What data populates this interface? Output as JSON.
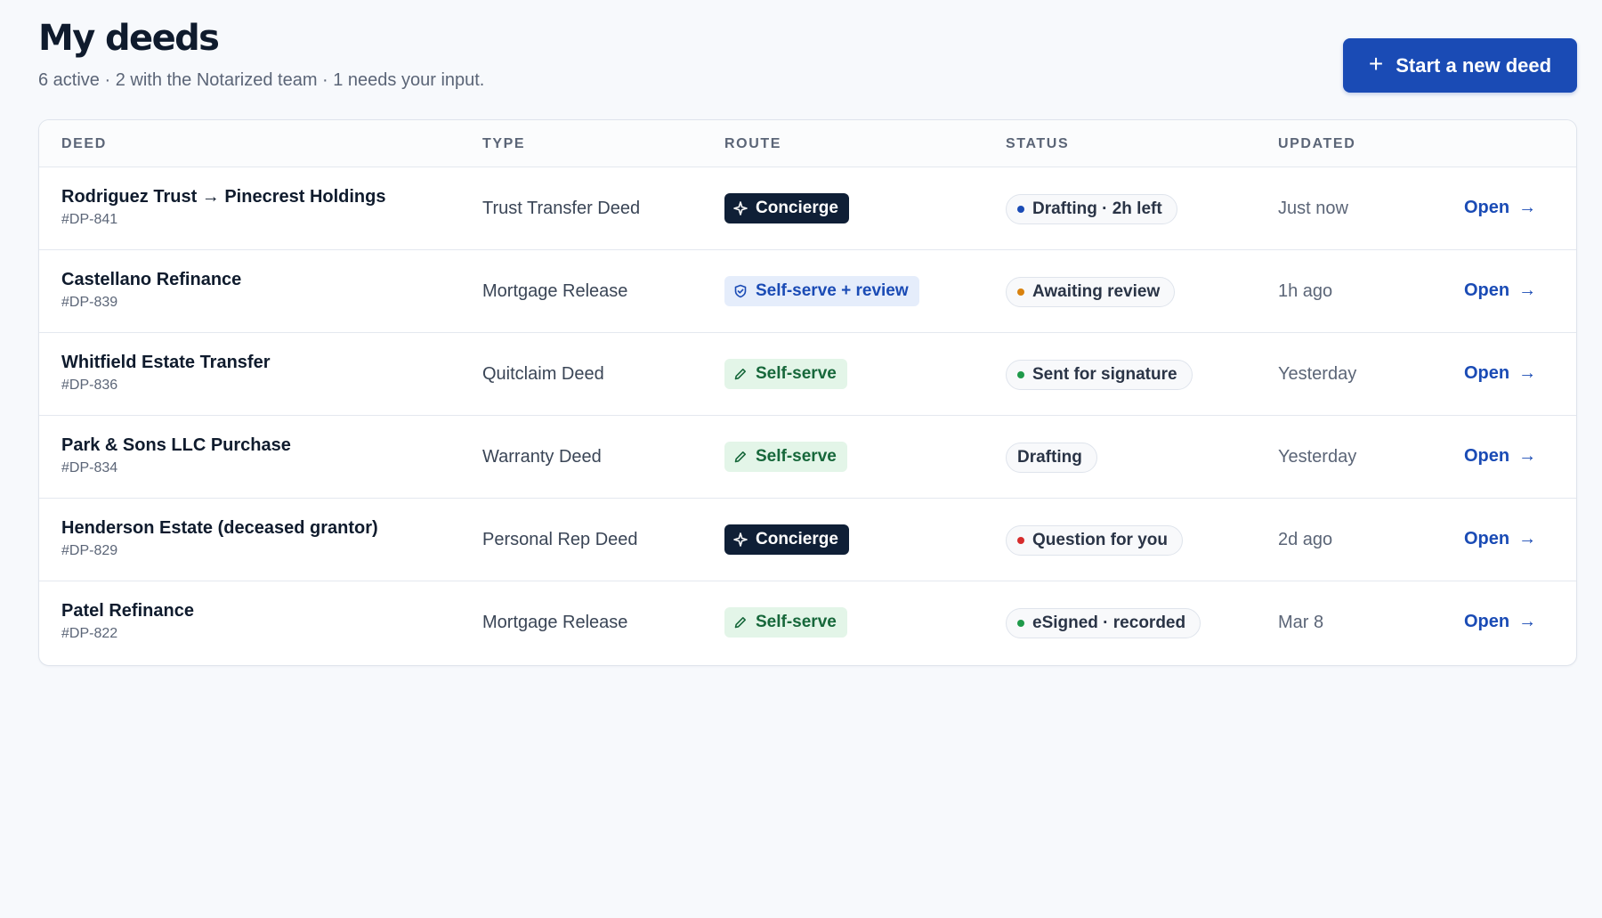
{
  "header": {
    "title": "My deeds",
    "subtitle": "6 active · 2 with the Notarized team · 1 needs your input.",
    "new_button_label": "Start a new deed",
    "new_button_icon": "plus-icon"
  },
  "table": {
    "columns": [
      "DEED",
      "TYPE",
      "ROUTE",
      "STATUS",
      "UPDATED"
    ],
    "open_label": "Open",
    "rows": [
      {
        "name": "Rodriguez Trust → Pinecrest Holdings",
        "id": "#DP-841",
        "type": "Trust Transfer Deed",
        "route": "Concierge",
        "route_kind": "concierge",
        "route_icon": "sparkle-icon",
        "status": "Drafting · 2h left",
        "status_color": "#1a4bb5",
        "updated": "Just now"
      },
      {
        "name": "Castellano Refinance",
        "id": "#DP-839",
        "type": "Mortgage Release",
        "route": "Self-serve + review",
        "route_kind": "review",
        "route_icon": "shield-icon",
        "status": "Awaiting review",
        "status_color": "#d9820f",
        "updated": "1h ago"
      },
      {
        "name": "Whitfield Estate Transfer",
        "id": "#DP-836",
        "type": "Quitclaim Deed",
        "route": "Self-serve",
        "route_kind": "selfserve",
        "route_icon": "pencil-icon",
        "status": "Sent for signature",
        "status_color": "#1f9a4a",
        "updated": "Yesterday"
      },
      {
        "name": "Park & Sons LLC Purchase",
        "id": "#DP-834",
        "type": "Warranty Deed",
        "route": "Self-serve",
        "route_kind": "selfserve",
        "route_icon": "pencil-icon",
        "status": "Drafting",
        "status_color": "",
        "updated": "Yesterday"
      },
      {
        "name": "Henderson Estate (deceased grantor)",
        "id": "#DP-829",
        "type": "Personal Rep Deed",
        "route": "Concierge",
        "route_kind": "concierge",
        "route_icon": "sparkle-icon",
        "status": "Question for you",
        "status_color": "#d62c2c",
        "updated": "2d ago"
      },
      {
        "name": "Patel Refinance",
        "id": "#DP-822",
        "type": "Mortgage Release",
        "route": "Self-serve",
        "route_kind": "selfserve",
        "route_icon": "pencil-icon",
        "status": "eSigned · recorded",
        "status_color": "#1f9a4a",
        "updated": "Mar 8"
      }
    ]
  },
  "colors": {
    "accent": "#1a4bb5",
    "concierge_bg": "#0f1f36",
    "review_bg": "#e5edfb",
    "selfserve_bg": "#e3f5e8"
  }
}
